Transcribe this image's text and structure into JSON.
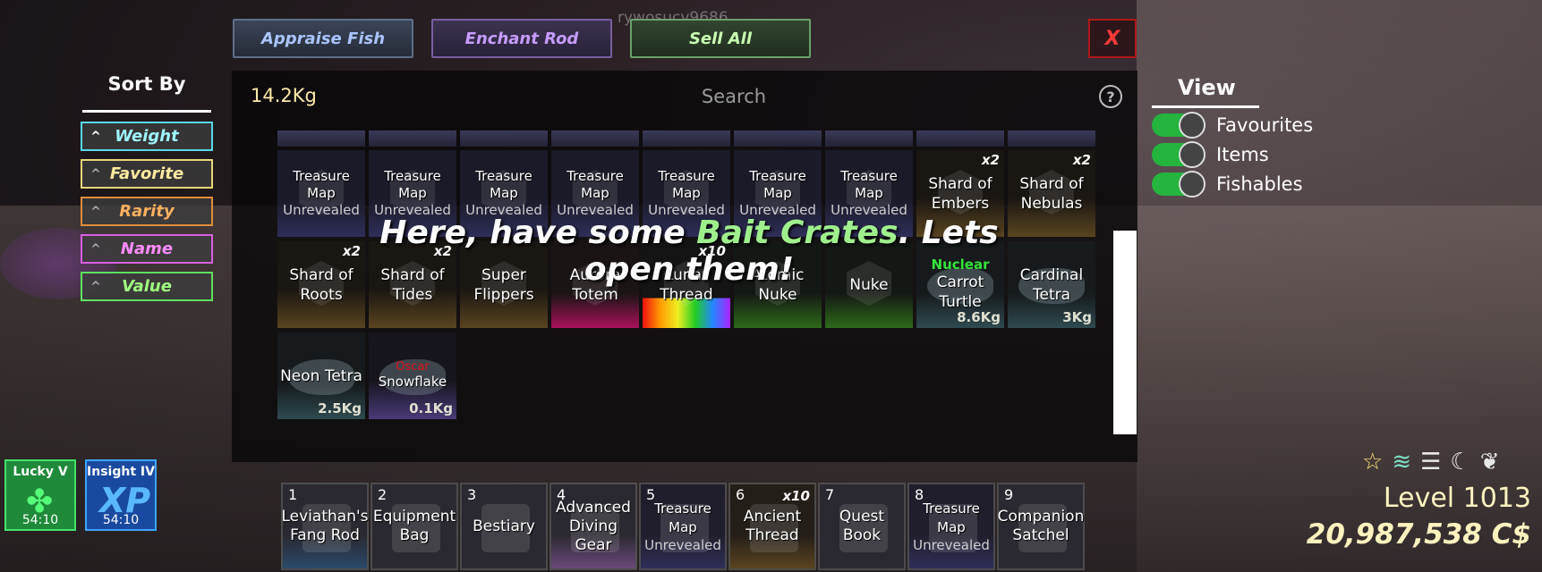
{
  "player_name": "rywosucy9686",
  "top_buttons": {
    "appraise": "Appraise Fish",
    "enchant": "Enchant Rod",
    "sell_all": "Sell All",
    "close": "X"
  },
  "sort": {
    "title": "Sort By",
    "options": [
      {
        "label": "Weight",
        "color": "#9ff5ff",
        "border": "#59d9e8"
      },
      {
        "label": "Favorite",
        "color": "#ffeaa0",
        "border": "#e8d57a"
      },
      {
        "label": "Rarity",
        "color": "#ffb060",
        "border": "#e08d3a"
      },
      {
        "label": "Name",
        "color": "#ff8cff",
        "border": "#d85fe0"
      },
      {
        "label": "Value",
        "color": "#a0ff80",
        "border": "#5fe05f"
      }
    ]
  },
  "inventory": {
    "total_weight": "14.2Kg",
    "search_placeholder": "Search",
    "help_icon": "?",
    "banner_prefix": "Here, have some ",
    "banner_highlight": "Bait Crates",
    "banner_suffix": ". Lets open them!",
    "row1": [
      {
        "name": "Treasure Map",
        "sub": "Unrevealed"
      },
      {
        "name": "Treasure Map",
        "sub": "Unrevealed"
      },
      {
        "name": "Treasure Map",
        "sub": "Unrevealed"
      },
      {
        "name": "Treasure Map",
        "sub": "Unrevealed"
      },
      {
        "name": "Treasure Map",
        "sub": "Unrevealed"
      },
      {
        "name": "Treasure Map",
        "sub": "Unrevealed"
      },
      {
        "name": "Treasure Map",
        "sub": "Unrevealed"
      },
      {
        "name": "Shard of Embers",
        "count": "x2"
      },
      {
        "name": "Shard of Nebulas",
        "count": "x2"
      }
    ],
    "row2": [
      {
        "name": "Shard of Roots",
        "count": "x2"
      },
      {
        "name": "Shard of Tides",
        "count": "x2"
      },
      {
        "name": "Super Flippers"
      },
      {
        "name": "Aurora Totem"
      },
      {
        "name": "Lunar Thread",
        "count": "x10"
      },
      {
        "name": "Atomic Nuke"
      },
      {
        "name": "Nuke"
      },
      {
        "name": "Carrot Turtle",
        "mutation": "Nuclear",
        "weight": "8.6Kg"
      },
      {
        "name": "Cardinal Tetra",
        "weight": "3Kg"
      }
    ],
    "row3": [
      {
        "name": "Neon Tetra",
        "weight": "2.5Kg"
      },
      {
        "name": "Snowflake",
        "mutation": "Oscar",
        "weight": "0.1Kg"
      }
    ]
  },
  "view": {
    "title": "View",
    "toggles": [
      {
        "label": "Favourites",
        "on": true
      },
      {
        "label": "Items",
        "on": true
      },
      {
        "label": "Fishables",
        "on": true
      }
    ]
  },
  "buffs": [
    {
      "name": "Lucky V",
      "time": "54:10",
      "icon": "clover-icon"
    },
    {
      "name": "Insight IV",
      "time": "54:10",
      "icon": "xp-icon"
    }
  ],
  "hotbar": [
    {
      "num": "1",
      "name": "Leviathan's Fang Rod"
    },
    {
      "num": "2",
      "name": "Equipment Bag"
    },
    {
      "num": "3",
      "name": "Bestiary"
    },
    {
      "num": "4",
      "name": "Advanced Diving Gear"
    },
    {
      "num": "5",
      "name": "Treasure Map",
      "sub": "Unrevealed"
    },
    {
      "num": "6",
      "name": "Ancient Thread",
      "count": "x10"
    },
    {
      "num": "7",
      "name": "Quest Book"
    },
    {
      "num": "8",
      "name": "Treasure Map",
      "sub": "Unrevealed"
    },
    {
      "num": "9",
      "name": "Companion Satchel"
    }
  ],
  "status": {
    "level": "Level 1013",
    "money": "20,987,538 C$",
    "icons": [
      "star-icon",
      "waves-icon",
      "wind-icon",
      "moon-icon",
      "leaf-icon"
    ]
  }
}
